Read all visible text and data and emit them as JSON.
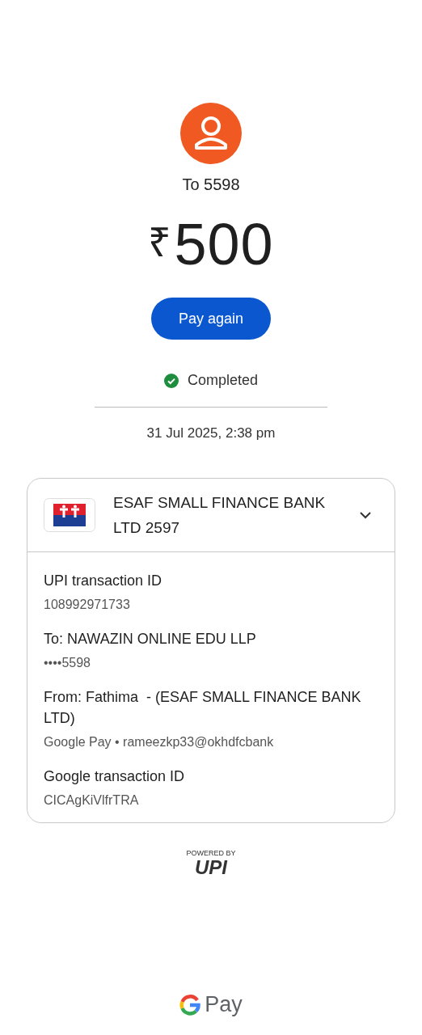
{
  "recipient": "To 5598",
  "amount": {
    "currency": "₹",
    "value": "500"
  },
  "pay_again_button": "Pay again",
  "status": {
    "label": "Completed",
    "kind": "success"
  },
  "datetime": "31 Jul 2025, 2:38 pm",
  "account": {
    "bank": "ESAF SMALL FINANCE BANK LTD 2597",
    "expanded": true
  },
  "details": [
    {
      "label": "UPI transaction ID",
      "value": "108992971733"
    },
    {
      "label": "To: NAWAZIN ONLINE EDU LLP",
      "value": "••••5598"
    },
    {
      "label": "From: Fathima  - (ESAF SMALL FINANCE BANK LTD)",
      "value": "Google Pay • rameezkp33@okhdfcbank"
    },
    {
      "label": "Google transaction ID",
      "value": "CICAgKiVlfrTRA"
    }
  ],
  "upi_badge": {
    "caption": "POWERED BY",
    "mark": "UPI"
  },
  "footer_brand": "Pay"
}
